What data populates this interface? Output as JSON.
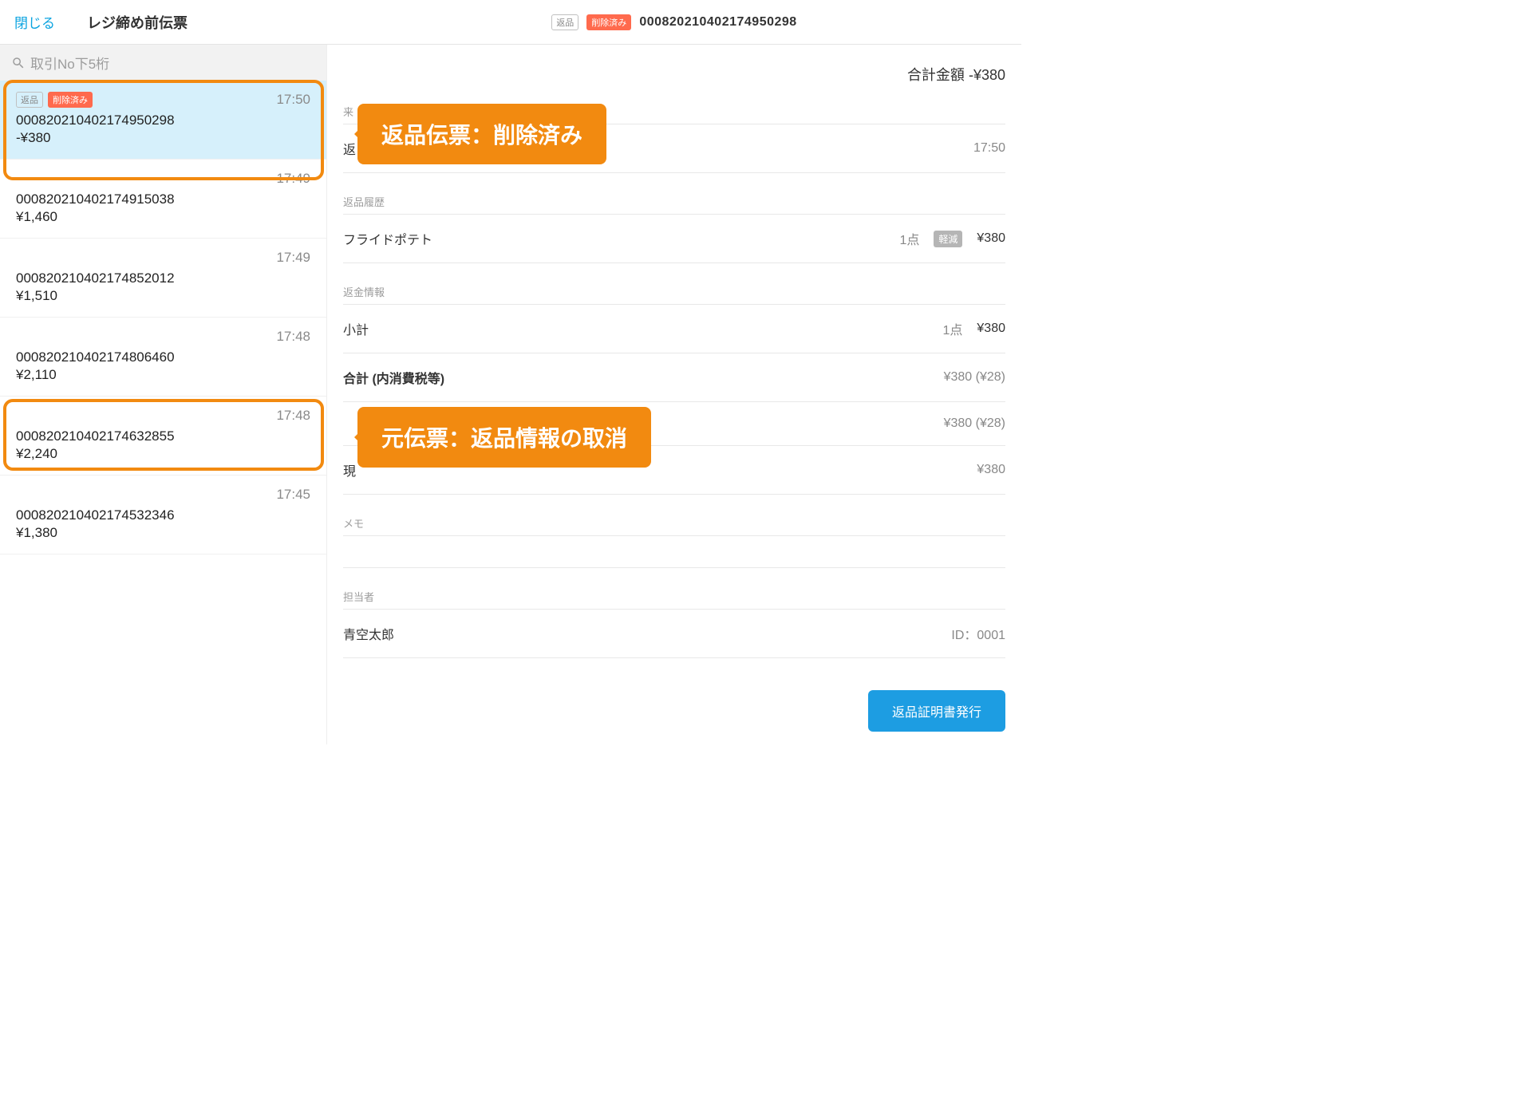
{
  "header": {
    "close": "閉じる",
    "title": "レジ締め前伝票",
    "badge_return": "返品",
    "badge_deleted": "削除済み",
    "transaction_id": "000820210402174950298"
  },
  "search": {
    "placeholder": "取引No下5桁"
  },
  "transactions": [
    {
      "time": "17:50",
      "id": "000820210402174950298",
      "amount": "-¥380",
      "has_badges": true
    },
    {
      "time": "17:49",
      "id": "000820210402174915038",
      "amount": "¥1,460",
      "has_badges": false
    },
    {
      "time": "17:49",
      "id": "000820210402174852012",
      "amount": "¥1,510",
      "has_badges": false
    },
    {
      "time": "17:48",
      "id": "000820210402174806460",
      "amount": "¥2,110",
      "has_badges": false
    },
    {
      "time": "17:48",
      "id": "000820210402174632855",
      "amount": "¥2,240",
      "has_badges": false
    },
    {
      "time": "17:45",
      "id": "000820210402174532346",
      "amount": "¥1,380",
      "has_badges": false
    }
  ],
  "detail": {
    "total_label": "合計金額",
    "total_value": "-¥380",
    "visit_label": "来",
    "return_row": {
      "left": "返",
      "right": "17:50"
    },
    "history_label": "返品履歴",
    "item": {
      "name": "フライドポテト",
      "qty": "1点",
      "tax_badge": "軽減",
      "price": "¥380"
    },
    "refund_label": "返金情報",
    "subtotal": {
      "label": "小計",
      "qty": "1点",
      "price": "¥380"
    },
    "grand": {
      "label": "合計 (内消費税等)",
      "price": "¥380 (¥28)"
    },
    "row_a": "¥380 (¥28)",
    "cash": {
      "label": "現",
      "price": "¥380"
    },
    "memo_label": "メモ",
    "staff_label": "担当者",
    "staff_name": "青空太郎",
    "staff_id": "ID：0001",
    "button": "返品証明書発行"
  },
  "callouts": {
    "top": "返品伝票：削除済み",
    "bottom": "元伝票：返品情報の取消"
  }
}
